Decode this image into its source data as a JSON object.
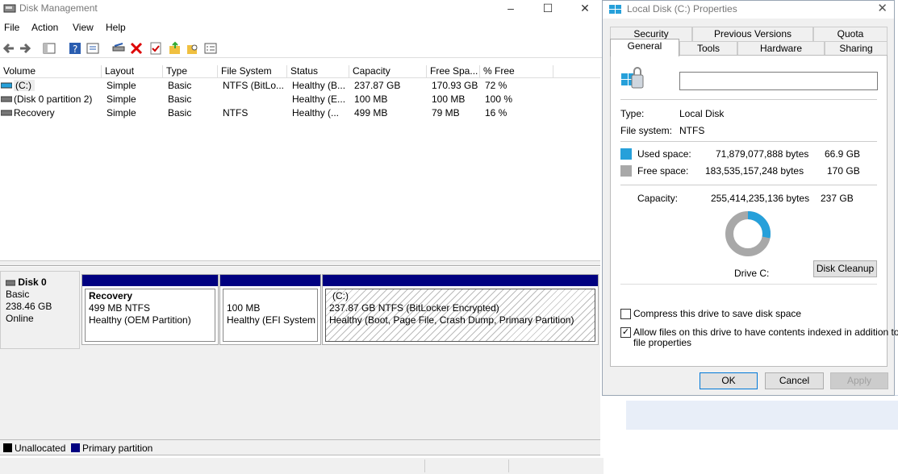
{
  "dm": {
    "title": "Disk Management",
    "menu": [
      "File",
      "Action",
      "View",
      "Help"
    ],
    "columns": [
      "Volume",
      "Layout",
      "Type",
      "File System",
      "Status",
      "Capacity",
      "Free Spa...",
      "% Free"
    ],
    "rows": [
      {
        "volume": "(C:)",
        "layout": "Simple",
        "type": "Basic",
        "fs": "NTFS (BitLo...",
        "status": "Healthy (B...",
        "capacity": "237.87 GB",
        "free": "170.93 GB",
        "pct": "72 %"
      },
      {
        "volume": "(Disk 0 partition 2)",
        "layout": "Simple",
        "type": "Basic",
        "fs": "",
        "status": "Healthy (E...",
        "capacity": "100 MB",
        "free": "100 MB",
        "pct": "100 %"
      },
      {
        "volume": "Recovery",
        "layout": "Simple",
        "type": "Basic",
        "fs": "NTFS",
        "status": "Healthy (...",
        "capacity": "499 MB",
        "free": "79 MB",
        "pct": "16 %"
      }
    ],
    "disk": {
      "name": "Disk 0",
      "type": "Basic",
      "size": "238.46 GB",
      "state": "Online"
    },
    "partitions": [
      {
        "name": "Recovery",
        "size": "499 MB NTFS",
        "status": "Healthy (OEM Partition)"
      },
      {
        "name": "",
        "size": "100 MB",
        "status": "Healthy (EFI System P"
      },
      {
        "name": "(C:)",
        "size": "237.87 GB NTFS (BitLocker Encrypted)",
        "status": "Healthy (Boot, Page File, Crash Dump, Primary Partition)"
      }
    ],
    "legend": {
      "unallocated": "Unallocated",
      "primary": "Primary partition",
      "unallocated_color": "#000000",
      "primary_color": "#000080"
    }
  },
  "props": {
    "title": "Local Disk (C:) Properties",
    "tabs_top": [
      "Security",
      "Previous Versions",
      "Quota"
    ],
    "tabs_bottom": [
      "General",
      "Tools",
      "Hardware",
      "Sharing"
    ],
    "name_value": "",
    "type_label": "Type:",
    "type_value": "Local Disk",
    "fs_label": "File system:",
    "fs_value": "NTFS",
    "used_label": "Used space:",
    "used_bytes": "71,879,077,888 bytes",
    "used_gb": "66.9 GB",
    "used_color": "#26a0da",
    "free_label": "Free space:",
    "free_bytes": "183,535,157,248 bytes",
    "free_gb": "170 GB",
    "free_color": "#a8a8a8",
    "cap_label": "Capacity:",
    "cap_bytes": "255,414,235,136 bytes",
    "cap_gb": "237 GB",
    "used_fraction": 0.281,
    "drive_label": "Drive C:",
    "cleanup": "Disk Cleanup",
    "compress": "Compress this drive to save disk space",
    "compress_checked": false,
    "index_line1": "Allow files on this drive to have contents indexed in addition to",
    "index_line2": "file properties",
    "index_checked": true,
    "ok": "OK",
    "cancel": "Cancel",
    "apply": "Apply"
  }
}
